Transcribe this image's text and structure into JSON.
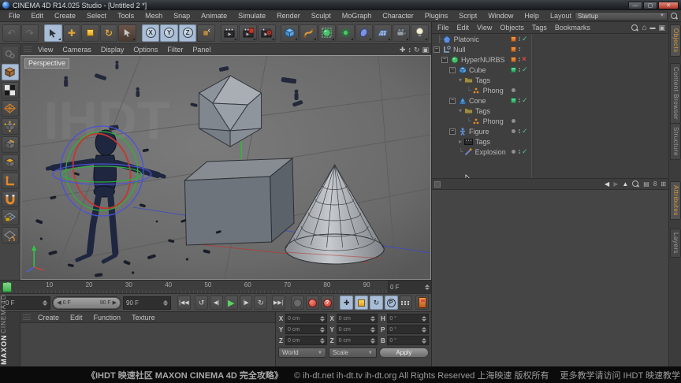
{
  "window": {
    "title": "CINEMA 4D R14.025 Studio - [Untitled 2 *]",
    "min": "—",
    "max": "▢",
    "close": "✕"
  },
  "menubar": {
    "items": [
      "File",
      "Edit",
      "Create",
      "Select",
      "Tools",
      "Mesh",
      "Snap",
      "Animate",
      "Simulate",
      "Render",
      "Sculpt",
      "MoGraph",
      "Character",
      "Plugins",
      "Script",
      "Window",
      "Help"
    ],
    "layout_label": "Layout",
    "layout_value": "Startup"
  },
  "viewport": {
    "menus": [
      "View",
      "Cameras",
      "Display",
      "Options",
      "Filter",
      "Panel"
    ],
    "view_label": "Perspective",
    "watermark": "IHDT"
  },
  "object_manager": {
    "menus": [
      "File",
      "Edit",
      "View",
      "Objects",
      "Tags",
      "Bookmarks"
    ],
    "tree": [
      "Platonic",
      "Null",
      "HyperNURBS",
      "Cube",
      "Tags",
      "Phong",
      "Cone",
      "Tags",
      "Phong",
      "Figure",
      "Tags",
      "Explosion FX"
    ]
  },
  "right_tabs": {
    "top": [
      "Objects",
      "Content Browser",
      "Structure"
    ],
    "bottom": [
      "Attributes",
      "Layers"
    ]
  },
  "timeline": {
    "ticks": [
      "0",
      "10",
      "20",
      "30",
      "40",
      "50",
      "60",
      "70",
      "80",
      "90"
    ],
    "current_frame": "0 F",
    "range_start": "0 F",
    "range_end": "90 F",
    "end_frame": "90 F"
  },
  "materials": {
    "menus": [
      "Create",
      "Edit",
      "Function",
      "Texture"
    ]
  },
  "coordinates": {
    "pos_labels": [
      "X",
      "Y",
      "Z"
    ],
    "pos_values": [
      "0 cm",
      "0 cm",
      "0 cm"
    ],
    "size_labels": [
      "X",
      "Y",
      "Z"
    ],
    "size_values": [
      "0 cm",
      "0 cm",
      "0 cm"
    ],
    "rot_labels": [
      "H",
      "P",
      "B"
    ],
    "rot_values": [
      "0 °",
      "0 °",
      "0 °"
    ],
    "mode_space": "World",
    "mode_size": "Scale",
    "apply_label": "Apply"
  },
  "brand": {
    "maxon": "MAXON",
    "cinema": "CINEMA4D"
  },
  "footer": {
    "left": "《IHDT 映速社区 MAXON CINEMA 4D 完全攻略》",
    "mid": "© ih-dt.net ih-dt.tv ih-dt.org  All Rights Reserved 上海映速 版权所有",
    "right": "更多教学请访问 IHDT 映速教学：ih-dt.org"
  },
  "colors": {
    "accent_orange": "#d9772a",
    "accent_green": "#3ec878",
    "active_blue": "#a9bdd6",
    "play_green": "#58d45e",
    "tag_red": "#e04b3f"
  }
}
